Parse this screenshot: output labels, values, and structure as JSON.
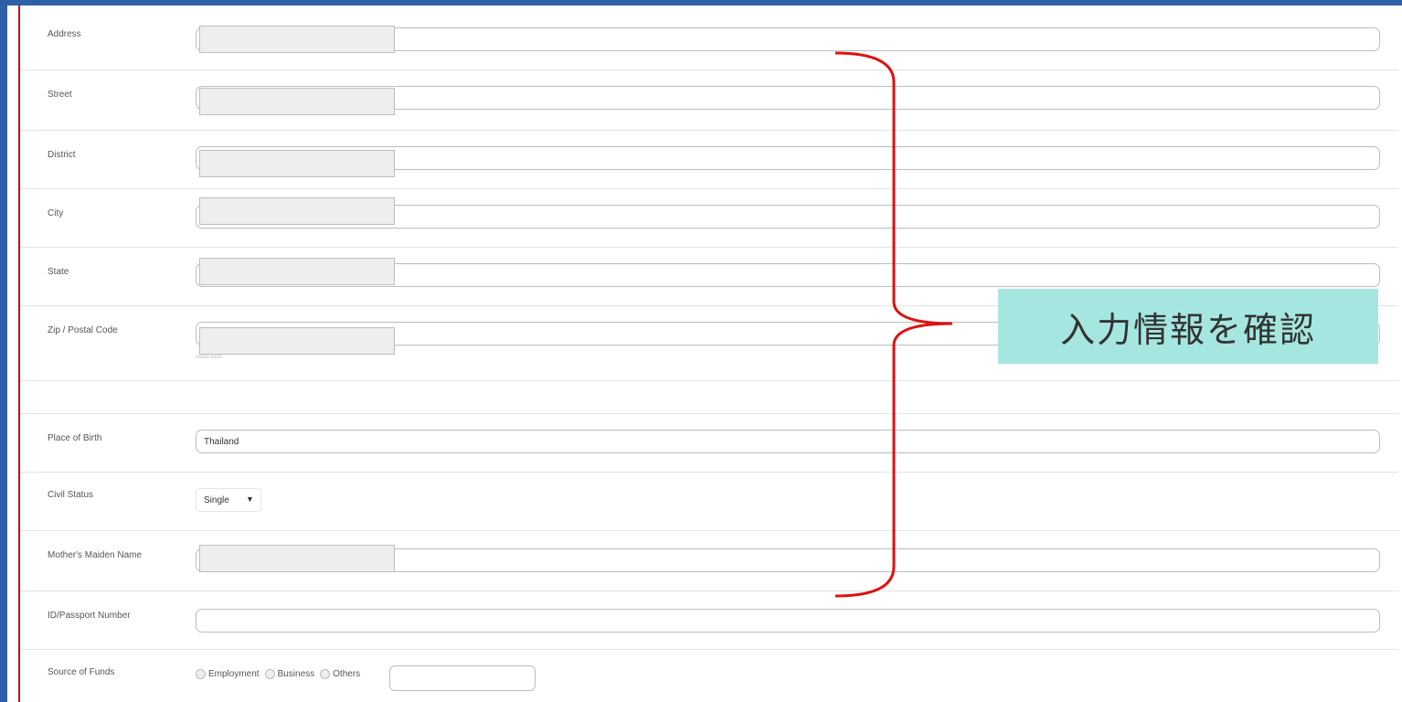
{
  "form": {
    "rows": [
      {
        "label": "Address"
      },
      {
        "label": "Street"
      },
      {
        "label": "District"
      },
      {
        "label": "City"
      },
      {
        "label": "State"
      },
      {
        "label": "Zip / Postal Code",
        "hint": "xxxxx-xxxx"
      },
      {
        "label": ""
      },
      {
        "label": "Place of Birth",
        "value": "Thailand"
      },
      {
        "label": "Civil Status",
        "value": "Single"
      },
      {
        "label": "Mother's Maiden Name"
      },
      {
        "label": "ID/Passport Number"
      },
      {
        "label": "Source of Funds"
      }
    ],
    "source_of_funds_options": [
      "Employment",
      "Business",
      "Others"
    ]
  },
  "annotation": {
    "callout_text": "入力情報を確認",
    "brace_color": "#e01010",
    "callout_bg": "#a6e6e0"
  },
  "colors": {
    "background": "#2f5fa8",
    "accent_edge": "#c21010"
  }
}
